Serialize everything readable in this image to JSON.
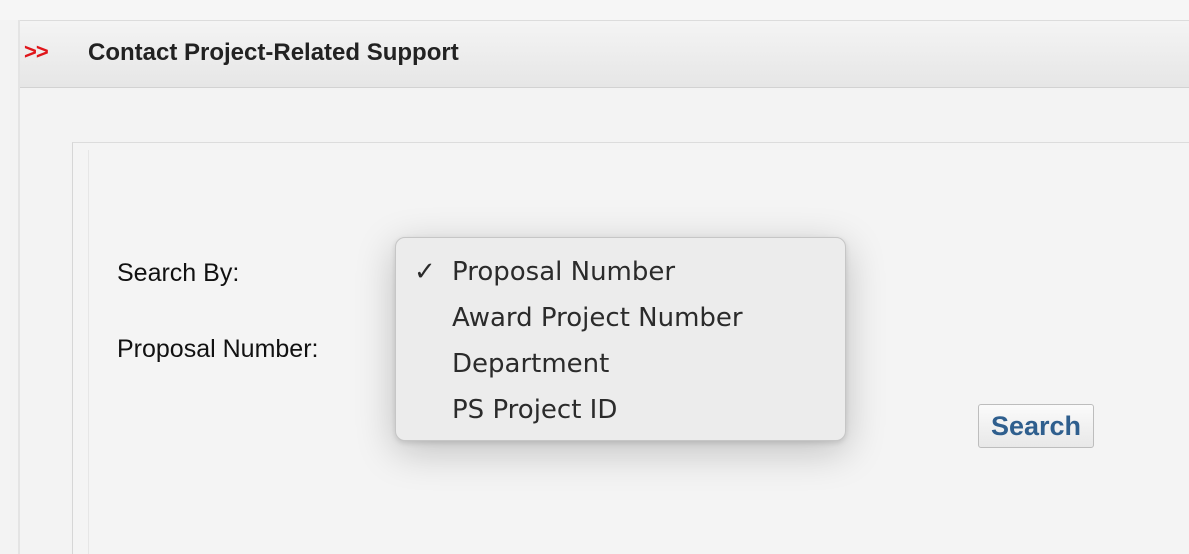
{
  "header": {
    "arrows": ">>",
    "title": "Contact Project-Related Support"
  },
  "form": {
    "search_by_label": "Search By:",
    "proposal_label": "Proposal Number:",
    "search_button": "Search"
  },
  "dropdown": {
    "selected": "Proposal Number",
    "check": "✓",
    "options": [
      "Proposal Number",
      "Award Project Number",
      "Department",
      "PS Project ID"
    ]
  },
  "colors": {
    "arrows": "#e0161b",
    "button_text": "#2f5f8e"
  },
  "icons": {
    "check": "check-icon"
  }
}
